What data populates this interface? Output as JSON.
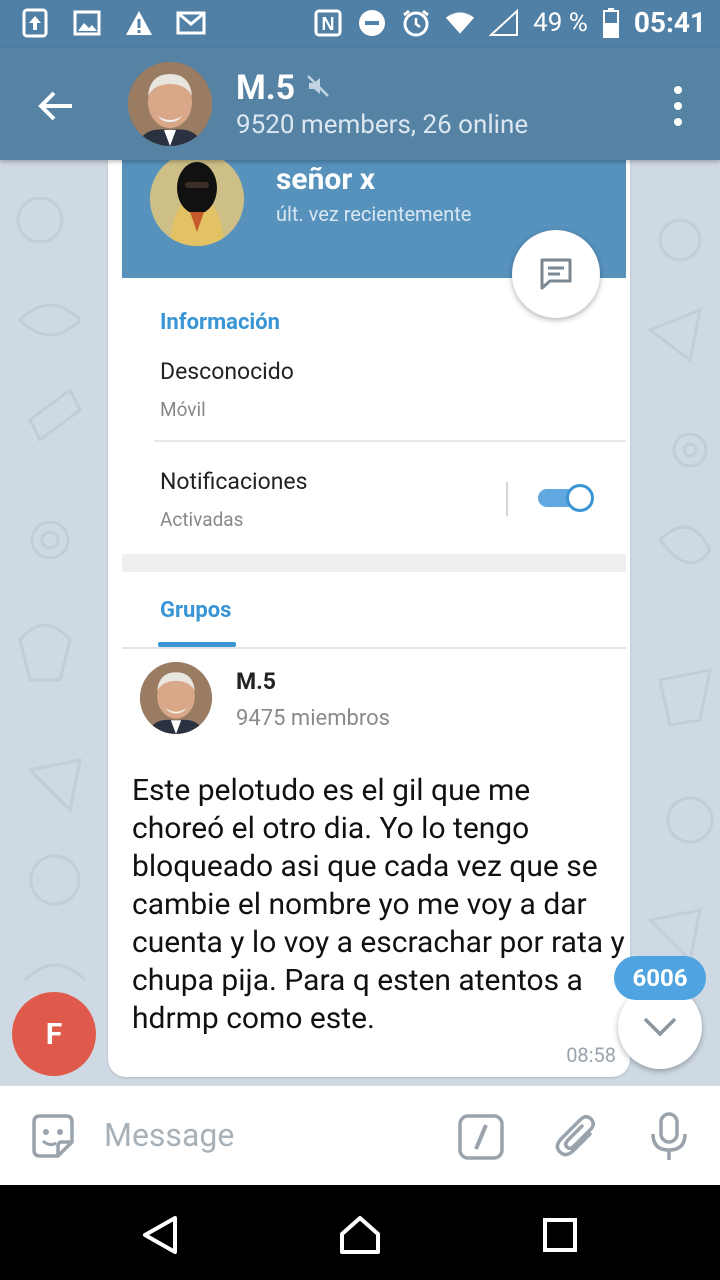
{
  "status_bar": {
    "battery_percent": "49 %",
    "time": "05:41"
  },
  "header": {
    "title": "M.5",
    "subtitle": "9520 members, 26 online"
  },
  "message": {
    "screenshot": {
      "profile_name": "señor x",
      "last_seen": "últ. vez recientemente",
      "info_section": "Información",
      "phone_value": "Desconocido",
      "phone_label": "Móvil",
      "notifications_label": "Notificaciones",
      "notifications_status": "Activadas",
      "groups_tab": "Grupos",
      "group_name": "M.5",
      "group_members": "9475 miembros"
    },
    "text": "Este pelotudo es el gil que me choreó el otro dia. Yo lo tengo bloqueado asi que cada vez que se cambie el nombre yo me voy a dar cuenta y lo voy a escrachar por rata y chupa pija. Para q esten atentos a hdrmp como este.",
    "time": "08:58",
    "sender_initial": "F"
  },
  "unread_count": "6006",
  "input": {
    "placeholder": "Message"
  },
  "colors": {
    "header": "#5682a3",
    "status_bar": "#5180a6",
    "accent": "#3a95d5",
    "sender_avatar": "#e05a4b",
    "badge": "#4fa3e0",
    "chat_bg": "#cfd9e3"
  }
}
